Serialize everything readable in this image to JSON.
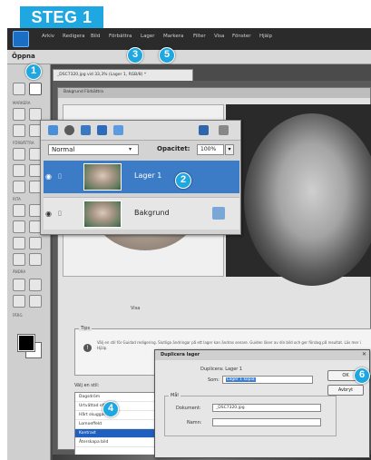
{
  "banner": {
    "text": "STEG 1"
  },
  "menubar": {
    "items": [
      "Arkiv",
      "Redigera",
      "Bild",
      "Förbättra",
      "Lager",
      "Markera",
      "Filter",
      "Visa",
      "Fönster",
      "Hjälp"
    ]
  },
  "options_bar": {
    "label": "Öppna"
  },
  "toolbox": {
    "labels": [
      "MARKERA",
      "FÖRBÄTTRA",
      "RITA",
      "ÄNDRA",
      "FÄRG"
    ]
  },
  "document": {
    "tab_label": "_DSC7320.jpg vid 33,3% (Lager 1, RGB/8) *"
  },
  "effect_dialog": {
    "title": "Bakgrund Förbättra",
    "preview_caption": "Visa",
    "tips_title": "Tips",
    "tips_icon": "!",
    "tips_text": "Välj en stil för Guidad redigering. Slutliga ändringar på ett lager kan ändras senare. Guiden läser av din bild och ger förslag på resultat. Läs mer i Hjälp.",
    "list_label": "Välj en stil:",
    "list_items": [
      "Dagsdröm",
      "Urtvättad effekt",
      "Hårt skuggad",
      "Lomoeffekt",
      "Kontrast",
      "Återskapa bild"
    ],
    "selected_index": 4
  },
  "layers_panel": {
    "blend_mode": "Normal",
    "opacity_label": "Opacitet:",
    "opacity_value": "100%",
    "layers": [
      {
        "name": "Lager 1",
        "active": true
      },
      {
        "name": "Bakgrund",
        "active": false
      }
    ]
  },
  "duplicate_dialog": {
    "title": "Duplicera lager",
    "duplicate_label": "Duplicera: Lager 1",
    "as_label": "Som:",
    "as_value": "Lager 1 kopia",
    "group_label": "Mål",
    "document_label": "Dokument:",
    "document_value": "_DSC7320.jpg",
    "name_label": "Namn:",
    "ok_label": "OK",
    "cancel_label": "Avbryt"
  },
  "callouts": [
    "1",
    "2",
    "3",
    "4",
    "5",
    "6"
  ],
  "colors": {
    "accent": "#1ea7e0",
    "active_layer": "#3c7cc7",
    "selection": "#1f5fbf"
  }
}
